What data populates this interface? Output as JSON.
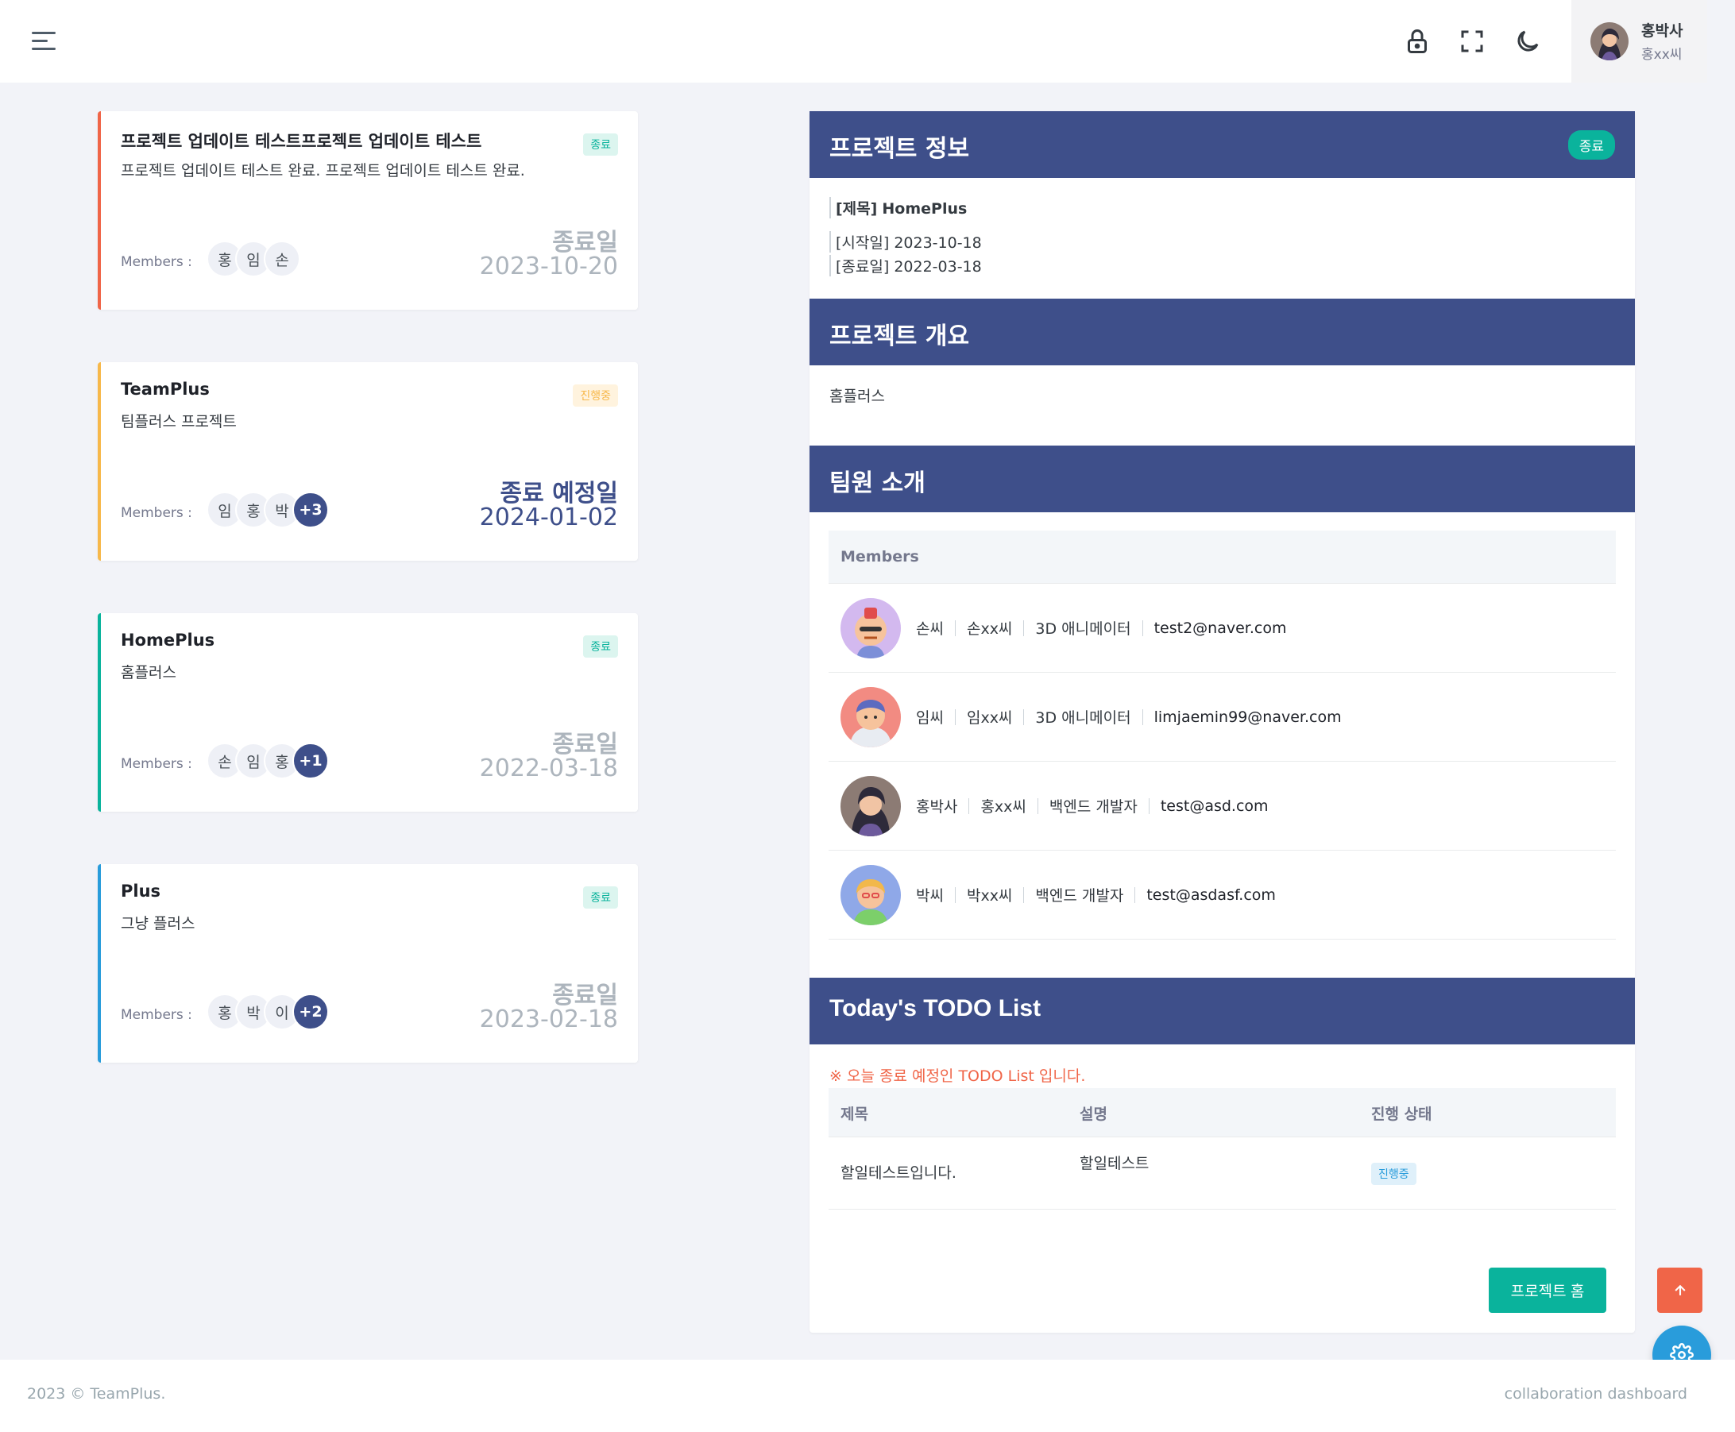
{
  "header": {
    "user_name": "홍박사",
    "user_sub": "홍xx씨"
  },
  "projects": [
    {
      "title": "프로젝트 업데이트 테스트프로젝트 업데이트 테스트",
      "desc": "프로젝트 업데이트 테스트 완료. 프로젝트 업데이트 테스트 완료.",
      "status": "종료",
      "members_label": "Members :",
      "members": [
        "홍",
        "임",
        "손"
      ],
      "more": "",
      "date_label": "종료일",
      "date": "2023-10-20",
      "color": "#f06548"
    },
    {
      "title": "TeamPlus",
      "desc": "팀플러스 프로젝트",
      "status": "진행중",
      "members_label": "Members :",
      "members": [
        "임",
        "홍",
        "박"
      ],
      "more": "+3",
      "date_label": "종료 예정일",
      "date": "2024-01-02",
      "color": "#f7b84b"
    },
    {
      "title": "HomePlus",
      "desc": "홈플러스",
      "status": "종료",
      "members_label": "Members :",
      "members": [
        "손",
        "임",
        "홍"
      ],
      "more": "+1",
      "date_label": "종료일",
      "date": "2022-03-18",
      "color": "#0ab39c"
    },
    {
      "title": "Plus",
      "desc": "그냥 플러스",
      "status": "종료",
      "members_label": "Members :",
      "members": [
        "홍",
        "박",
        "이"
      ],
      "more": "+2",
      "date_label": "종료일",
      "date": "2023-02-18",
      "color": "#299cdb"
    }
  ],
  "info": {
    "head": "프로젝트 정보",
    "badge": "종료",
    "title_label": "[제목]",
    "title_value": "HomePlus",
    "start_label": "[시작일]",
    "start_value": "2023-10-18",
    "end_label": "[종료일]",
    "end_value": "2022-03-18"
  },
  "overview": {
    "head": "프로젝트 개요",
    "text": "홈플러스"
  },
  "team": {
    "head": "팀원 소개",
    "table_head": "Members",
    "members": [
      {
        "name": "손씨",
        "nick": "손xx씨",
        "role": "3D 애니메이터",
        "email": "test2@naver.com"
      },
      {
        "name": "임씨",
        "nick": "임xx씨",
        "role": "3D 애니메이터",
        "email": "limjaemin99@naver.com"
      },
      {
        "name": "홍박사",
        "nick": "홍xx씨",
        "role": "백엔드 개발자",
        "email": "test@asd.com"
      },
      {
        "name": "박씨",
        "nick": "박xx씨",
        "role": "백엔드 개발자",
        "email": "test@asdasf.com"
      }
    ]
  },
  "todo": {
    "head": "Today's TODO List",
    "note": "※ 오늘 종료 예정인 TODO List 입니다.",
    "col_title": "제목",
    "col_desc": "설명",
    "col_status": "진행 상태",
    "rows": [
      {
        "title": "할일테스트입니다.",
        "desc": "할일테스트",
        "status": "진행중"
      }
    ],
    "button": "프로젝트 홈"
  },
  "footer": {
    "left": "2023 © TeamPlus.",
    "right": "collaboration dashboard"
  },
  "colors": {
    "primary": "#3e4f8a",
    "success": "#0ab39c",
    "warning": "#f7b84b",
    "danger": "#f06548",
    "info": "#299cdb"
  },
  "icons": [
    "menu-icon",
    "lock-icon",
    "fullscreen-icon",
    "moon-icon",
    "arrow-up-icon",
    "gear-icon"
  ]
}
